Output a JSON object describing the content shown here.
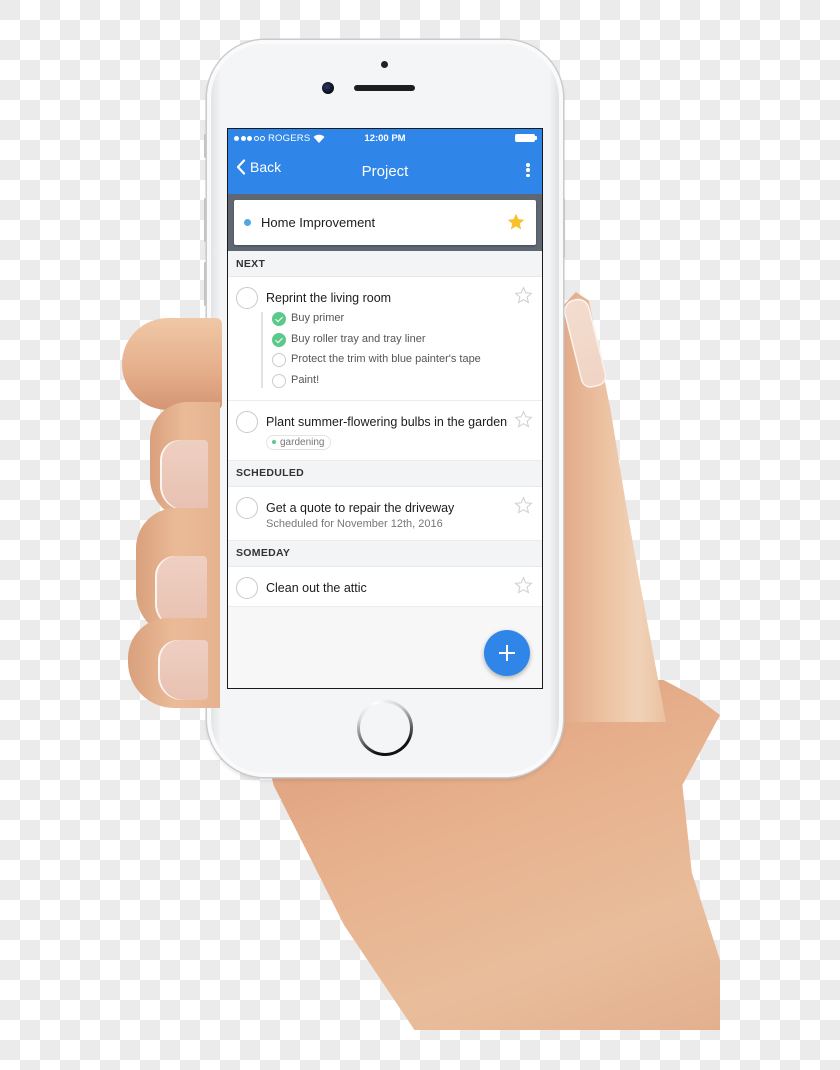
{
  "status_bar": {
    "signal_bars_filled": 3,
    "signal_bars_total": 5,
    "carrier": "ROGERS",
    "time": "12:00 PM"
  },
  "nav": {
    "back_label": "Back",
    "title": "Project"
  },
  "project": {
    "name": "Home Improvement",
    "dot_color": "#4fa8e0",
    "starred": true
  },
  "sections": [
    {
      "header": "NEXT",
      "tasks": [
        {
          "title": "Reprint the living room",
          "starred": false,
          "subtasks": [
            {
              "label": "Buy primer",
              "done": true
            },
            {
              "label": "Buy roller tray and tray liner",
              "done": true
            },
            {
              "label": "Protect the trim with blue painter's tape",
              "done": false
            },
            {
              "label": "Paint!",
              "done": false
            }
          ]
        },
        {
          "title": "Plant summer-flowering bulbs in the garden",
          "starred": false,
          "tag": "gardening"
        }
      ]
    },
    {
      "header": "SCHEDULED",
      "tasks": [
        {
          "title": "Get a quote to repair the driveway",
          "subtitle": "Scheduled for November 12th, 2016",
          "starred": false
        }
      ]
    },
    {
      "header": "SOMEDAY",
      "tasks": [
        {
          "title": "Clean out the attic",
          "starred": false
        }
      ]
    }
  ],
  "fab": {
    "icon": "plus-icon"
  },
  "colors": {
    "accent": "#2f86e8",
    "project_band": "#5f6872",
    "done_green": "#5cc98b",
    "star_yellow": "#f7c22e"
  }
}
